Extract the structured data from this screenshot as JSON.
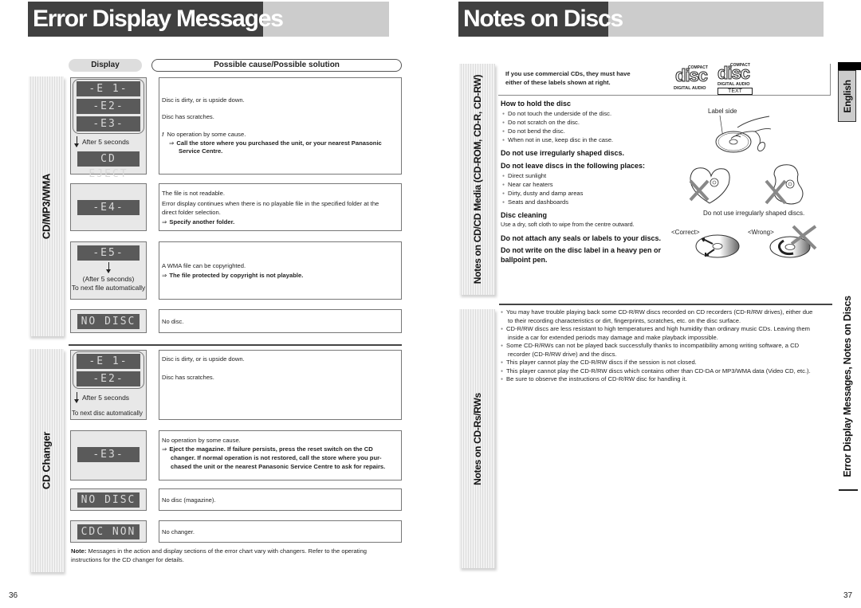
{
  "left_page": {
    "title": "Error Display Messages",
    "headers": {
      "display": "Display",
      "cause": "Possible cause/Possible solution"
    },
    "sections": {
      "cd_mp3_wma": "CD/MP3/WMA",
      "cd_changer": "CD Changer"
    },
    "cd_rows": [
      {
        "displays": [
          "-E 1-",
          "-E2-",
          "-E3-"
        ],
        "after": "After 5 seconds",
        "final_display": "CD EJECT",
        "causes": [
          {
            "text": "Disc is dirty, or is upside down."
          },
          {
            "text": "Disc has scratches."
          },
          {
            "icon": "!",
            "text": "No operation by some cause."
          },
          {
            "arrow": "⇒",
            "bold": "Call the store where you purchased the unit, or your nearest Panasonic",
            "bold2": "Service Centre."
          }
        ]
      },
      {
        "displays": [
          "-E4-"
        ],
        "causes": [
          {
            "text": "The file is not readable."
          },
          {
            "text": "Error display continues when there is no playable file in the specified folder at the"
          },
          {
            "text": "direct folder selection."
          },
          {
            "arrow": "⇒",
            "bold": "Specify another folder."
          }
        ]
      },
      {
        "displays": [
          "-E5-"
        ],
        "after_lines": [
          "(After 5 seconds)",
          "To next file automatically"
        ],
        "causes": [
          {
            "text": "A WMA file can be copyrighted."
          },
          {
            "arrow": "⇒",
            "bold": "The file protected by copyright is not playable."
          }
        ]
      },
      {
        "displays": [
          "NO DISC"
        ],
        "causes": [
          {
            "text": "No disc."
          }
        ]
      }
    ],
    "changer_rows": [
      {
        "displays": [
          "-E 1-",
          "-E2-"
        ],
        "after": "After 5 seconds",
        "after2": "To next disc automatically",
        "causes": [
          {
            "text": "Disc is dirty, or is upside down."
          },
          {
            "text": "Disc has scratches."
          }
        ]
      },
      {
        "displays": [
          "-E3-"
        ],
        "causes": [
          {
            "text": "No operation by some cause."
          },
          {
            "arrow": "⇒",
            "bold": "Eject the magazine. If failure persists, press the reset switch on the CD"
          },
          {
            "bold": "changer.  If normal operation is not restored, call the store where you pur-"
          },
          {
            "bold": "chased the unit or the nearest Panasonic Service Centre to ask for repairs."
          }
        ]
      },
      {
        "displays": [
          "NO DISC"
        ],
        "causes": [
          {
            "text": "No disc (magazine)."
          }
        ]
      },
      {
        "displays": [
          "CDC NON"
        ],
        "causes": [
          {
            "text": "No changer."
          }
        ]
      }
    ],
    "note_label": "Note:",
    "note_text": " Messages in the action and display sections of the error chart vary with changers. Refer to the operating instructions for the CD changer for details.",
    "page_number": "36"
  },
  "right_page": {
    "title": "Notes on Discs",
    "language_tab": "English",
    "side_title": "Error Display Messages, Notes on Discs",
    "sections": {
      "cd_media": "Notes on CD/CD Media (CD-ROM, CD-R, CD-RW)",
      "cdr_rw": "Notes on CD-Rs/RWs"
    },
    "commercial_note_line1": "If you use commercial CDs, they must have",
    "commercial_note_line2": "either of these labels shown at right.",
    "logos": [
      {
        "top": "COMPACT",
        "main": "disc",
        "bottom": "DIGITAL AUDIO"
      },
      {
        "top": "COMPACT",
        "main": "disc",
        "bottom": "DIGITAL AUDIO",
        "extra": "TEXT"
      }
    ],
    "hold_heading": "How to hold the disc",
    "hold_items": [
      "Do not touch the underside of the disc.",
      "Do not scratch on the disc.",
      "Do not bend the disc.",
      "When not in use, keep disc in the case."
    ],
    "label_side": "Label side",
    "irregular_heading": "Do not use irregularly shaped discs.",
    "leave_heading": "Do not leave discs in the following places:",
    "leave_items": [
      "Direct sunlight",
      "Near car heaters",
      "Dirty, dusty and damp areas",
      "Seats and dashboards"
    ],
    "irregular_caption": "Do not use irregularly shaped discs.",
    "cleaning_heading": "Disc cleaning",
    "cleaning_text": "Use a dry, soft cloth to wipe from the centre outward.",
    "correct_label": "<Correct>",
    "wrong_label": "<Wrong>",
    "seals_heading": "Do not attach any seals or labels to your discs.",
    "pen_heading_1": "Do not write on the disc label in a heavy pen or",
    "pen_heading_2": "ballpoint pen.",
    "cdr_items": [
      [
        "You may have trouble playing back some CD-R/RW discs recorded on CD recorders (CD-R/RW drives), either due",
        "to their recording characteristics or dirt, fingerprints, scratches, etc. on the disc surface."
      ],
      [
        "CD-R/RW discs are less resistant to high temperatures and high humidity than ordinary music CDs. Leaving them",
        "inside a car for extended periods may damage and make playback impossible."
      ],
      [
        "Some CD-R/RWs can not be played back successfully thanks to incompatibility among writing software, a CD",
        "recorder (CD-R/RW drive) and the discs."
      ],
      [
        "This player cannot play the CD-R/RW discs if the session is not closed."
      ],
      [
        "This player cannot play the CD-R/RW discs which contains other than CD-DA or MP3/WMA data (Video CD, etc.)."
      ],
      [
        "Be sure to observe the instructions of CD-R/RW disc for handling it."
      ]
    ],
    "page_number": "37"
  }
}
